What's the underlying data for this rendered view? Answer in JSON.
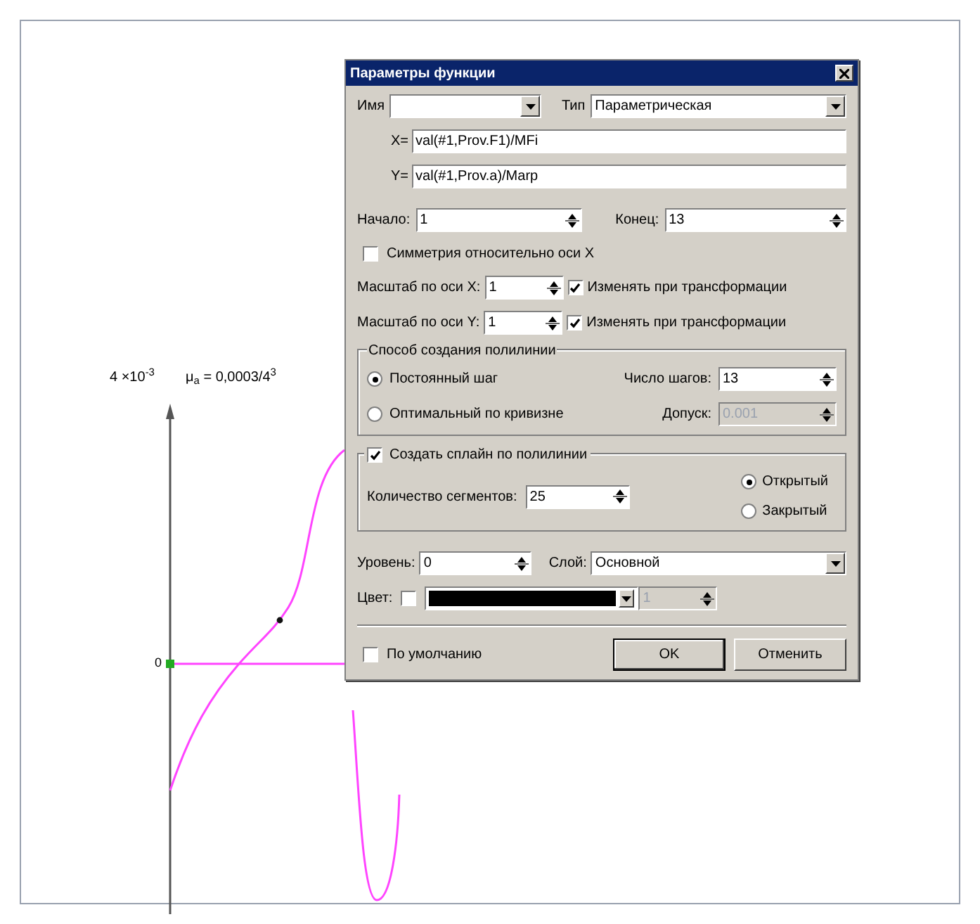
{
  "window": {
    "title": "Параметры функции"
  },
  "name_field": {
    "label": "Имя"
  },
  "type_field": {
    "label": "Тип",
    "value": "Параметрическая"
  },
  "x_expr": {
    "label": "X=",
    "value": "val(#1,Prov.F1)/MFi"
  },
  "y_expr": {
    "label": "Y=",
    "value": "val(#1,Prov.a)/Marp"
  },
  "start": {
    "label": "Начало:",
    "value": "1"
  },
  "end": {
    "label": "Конец:",
    "value": "13"
  },
  "symmetry": {
    "label": "Симметрия относительно оси X",
    "checked": false
  },
  "scales": [
    {
      "label": "Масштаб по оси X:",
      "value": "1",
      "transform_label": "Изменять при трансформации",
      "checked": true
    },
    {
      "label": "Масштаб по оси Y:",
      "value": "1",
      "transform_label": "Изменять при трансформации",
      "checked": true
    }
  ],
  "polyline_group": {
    "title": "Способ создания полилинии",
    "options": [
      {
        "label": "Постоянный шаг",
        "selected": true,
        "field_label": "Число шагов:",
        "value": "13",
        "disabled": false
      },
      {
        "label": "Оптимальный по кривизне",
        "selected": false,
        "field_label": "Допуск:",
        "value": "0.001",
        "disabled": true
      }
    ]
  },
  "spline_group": {
    "label": "Создать сплайн по полилинии",
    "checked": true,
    "segments_label": "Количество сегментов:",
    "segments": "25",
    "closure": [
      {
        "label": "Открытый",
        "selected": true
      },
      {
        "label": "Закрытый",
        "selected": false
      }
    ]
  },
  "level": {
    "label": "Уровень:",
    "value": "0"
  },
  "layer": {
    "label": "Слой:",
    "value": "Основной"
  },
  "color": {
    "label": "Цвет:",
    "checked": false,
    "value": "1",
    "disabled": true
  },
  "default": {
    "label": "По умолчанию",
    "checked": false
  },
  "buttons": [
    {
      "label": "OK",
      "default": true
    },
    {
      "label": "Отменить",
      "default": false
    }
  ],
  "drawing": {
    "axis_label": "4 ×10$^{-3}$",
    "formula": "μ$_{a}$ = 0,0003/4$^{3}$",
    "origin_label": "0"
  }
}
